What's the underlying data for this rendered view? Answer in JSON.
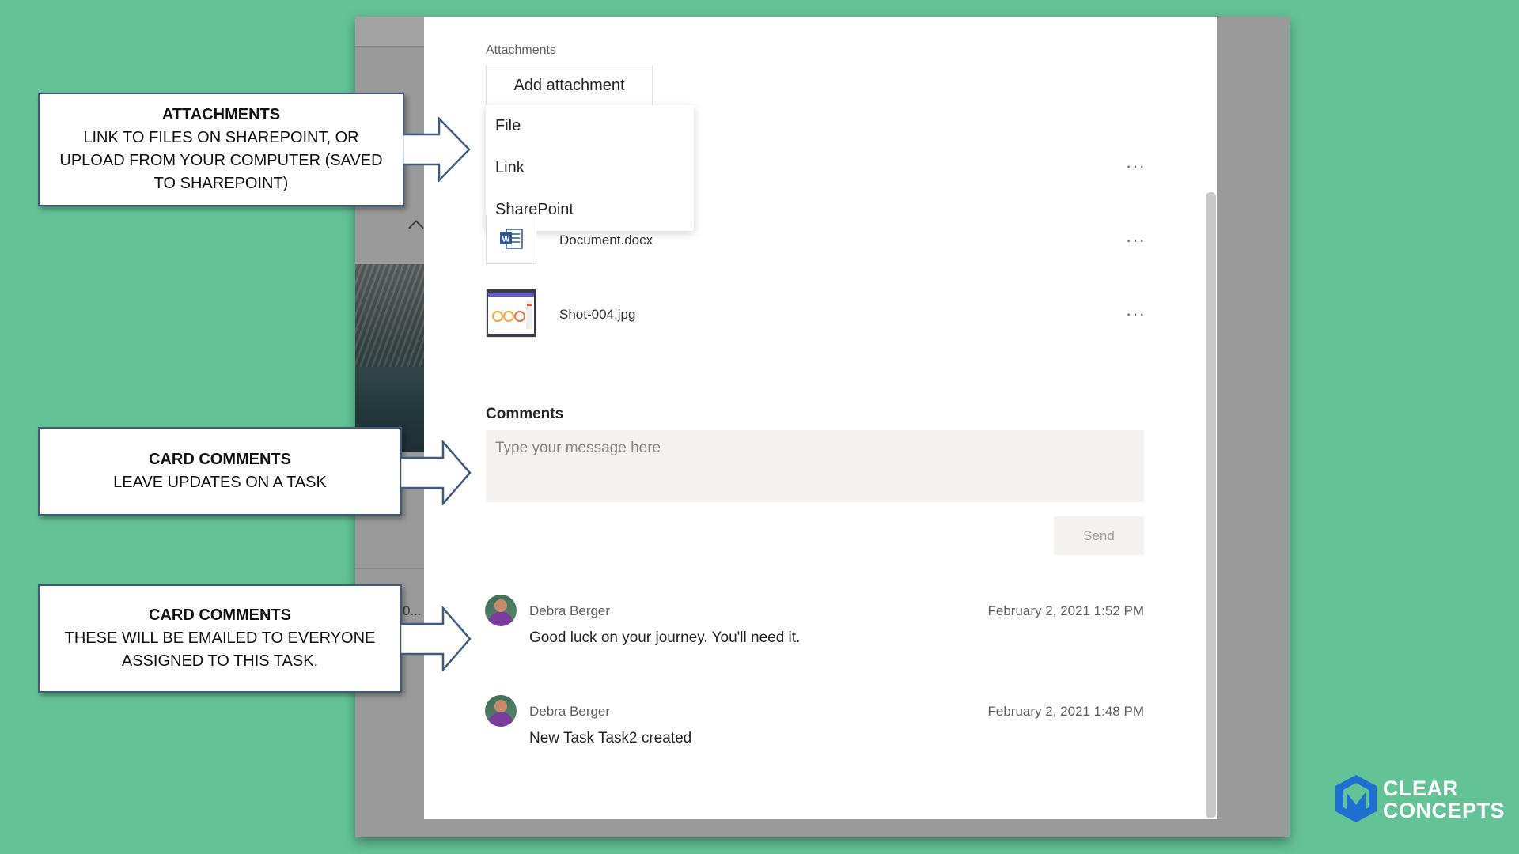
{
  "attachments": {
    "label": "Attachments",
    "add_button": "Add attachment",
    "menu": [
      "File",
      "Link",
      "SharePoint"
    ],
    "files": [
      {
        "name": "Document.docx",
        "icon": "word-document-icon"
      },
      {
        "name": "Shot-004.jpg",
        "icon": "image-thumbnail"
      }
    ],
    "more_symbol": "···"
  },
  "comments": {
    "title": "Comments",
    "placeholder": "Type your message here",
    "send_label": "Send",
    "items": [
      {
        "author": "Debra Berger",
        "date": "February 2, 2021 1:52 PM",
        "text": "Good luck on your journey. You'll need it."
      },
      {
        "author": "Debra Berger",
        "date": "February 2, 2021 1:48 PM",
        "text": "New Task Task2 created"
      }
    ]
  },
  "background": {
    "ellipsis": "0..."
  },
  "callouts": [
    {
      "title": "ATTACHMENTS",
      "body": "LINK TO FILES ON SHAREPOINT, OR UPLOAD FROM YOUR COMPUTER (SAVED TO SHAREPOINT)"
    },
    {
      "title": "CARD COMMENTS",
      "body": "LEAVE UPDATES ON A TASK"
    },
    {
      "title": "CARD COMMENTS",
      "body": "THESE WILL BE EMAILED TO EVERYONE ASSIGNED TO THIS TASK."
    }
  ],
  "logo": {
    "line1": "CLEAR",
    "line2": "CONCEPTS"
  },
  "colors": {
    "background": "#63c397",
    "callout_border": "#3d5a80",
    "word_blue": "#2b579a"
  }
}
